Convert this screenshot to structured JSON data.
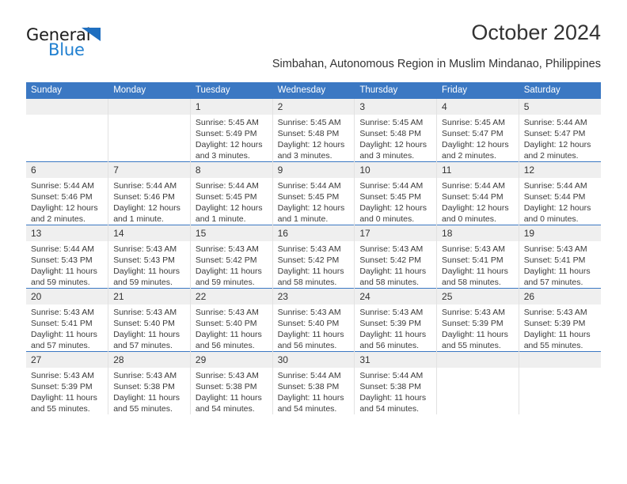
{
  "logo": {
    "word_one": "General",
    "word_two": "Blue",
    "triangle_color": "#1f6fc0",
    "blue_color": "#1f7fd0"
  },
  "header": {
    "title": "October 2024",
    "subtitle": "Simbahan, Autonomous Region in Muslim Mindanao, Philippines"
  },
  "theme": {
    "header_blue": "#3b78c3",
    "daynum_band": "#efefef",
    "cell_border": "#e2e2e2"
  },
  "weekday_headers": [
    "Sunday",
    "Monday",
    "Tuesday",
    "Wednesday",
    "Thursday",
    "Friday",
    "Saturday"
  ],
  "weeks": [
    [
      {
        "day": "",
        "lines": []
      },
      {
        "day": "",
        "lines": []
      },
      {
        "day": "1",
        "lines": [
          "Sunrise: 5:45 AM",
          "Sunset: 5:49 PM",
          "Daylight: 12 hours",
          "and 3 minutes."
        ]
      },
      {
        "day": "2",
        "lines": [
          "Sunrise: 5:45 AM",
          "Sunset: 5:48 PM",
          "Daylight: 12 hours",
          "and 3 minutes."
        ]
      },
      {
        "day": "3",
        "lines": [
          "Sunrise: 5:45 AM",
          "Sunset: 5:48 PM",
          "Daylight: 12 hours",
          "and 3 minutes."
        ]
      },
      {
        "day": "4",
        "lines": [
          "Sunrise: 5:45 AM",
          "Sunset: 5:47 PM",
          "Daylight: 12 hours",
          "and 2 minutes."
        ]
      },
      {
        "day": "5",
        "lines": [
          "Sunrise: 5:44 AM",
          "Sunset: 5:47 PM",
          "Daylight: 12 hours",
          "and 2 minutes."
        ]
      }
    ],
    [
      {
        "day": "6",
        "lines": [
          "Sunrise: 5:44 AM",
          "Sunset: 5:46 PM",
          "Daylight: 12 hours",
          "and 2 minutes."
        ]
      },
      {
        "day": "7",
        "lines": [
          "Sunrise: 5:44 AM",
          "Sunset: 5:46 PM",
          "Daylight: 12 hours",
          "and 1 minute."
        ]
      },
      {
        "day": "8",
        "lines": [
          "Sunrise: 5:44 AM",
          "Sunset: 5:45 PM",
          "Daylight: 12 hours",
          "and 1 minute."
        ]
      },
      {
        "day": "9",
        "lines": [
          "Sunrise: 5:44 AM",
          "Sunset: 5:45 PM",
          "Daylight: 12 hours",
          "and 1 minute."
        ]
      },
      {
        "day": "10",
        "lines": [
          "Sunrise: 5:44 AM",
          "Sunset: 5:45 PM",
          "Daylight: 12 hours",
          "and 0 minutes."
        ]
      },
      {
        "day": "11",
        "lines": [
          "Sunrise: 5:44 AM",
          "Sunset: 5:44 PM",
          "Daylight: 12 hours",
          "and 0 minutes."
        ]
      },
      {
        "day": "12",
        "lines": [
          "Sunrise: 5:44 AM",
          "Sunset: 5:44 PM",
          "Daylight: 12 hours",
          "and 0 minutes."
        ]
      }
    ],
    [
      {
        "day": "13",
        "lines": [
          "Sunrise: 5:44 AM",
          "Sunset: 5:43 PM",
          "Daylight: 11 hours",
          "and 59 minutes."
        ]
      },
      {
        "day": "14",
        "lines": [
          "Sunrise: 5:43 AM",
          "Sunset: 5:43 PM",
          "Daylight: 11 hours",
          "and 59 minutes."
        ]
      },
      {
        "day": "15",
        "lines": [
          "Sunrise: 5:43 AM",
          "Sunset: 5:42 PM",
          "Daylight: 11 hours",
          "and 59 minutes."
        ]
      },
      {
        "day": "16",
        "lines": [
          "Sunrise: 5:43 AM",
          "Sunset: 5:42 PM",
          "Daylight: 11 hours",
          "and 58 minutes."
        ]
      },
      {
        "day": "17",
        "lines": [
          "Sunrise: 5:43 AM",
          "Sunset: 5:42 PM",
          "Daylight: 11 hours",
          "and 58 minutes."
        ]
      },
      {
        "day": "18",
        "lines": [
          "Sunrise: 5:43 AM",
          "Sunset: 5:41 PM",
          "Daylight: 11 hours",
          "and 58 minutes."
        ]
      },
      {
        "day": "19",
        "lines": [
          "Sunrise: 5:43 AM",
          "Sunset: 5:41 PM",
          "Daylight: 11 hours",
          "and 57 minutes."
        ]
      }
    ],
    [
      {
        "day": "20",
        "lines": [
          "Sunrise: 5:43 AM",
          "Sunset: 5:41 PM",
          "Daylight: 11 hours",
          "and 57 minutes."
        ]
      },
      {
        "day": "21",
        "lines": [
          "Sunrise: 5:43 AM",
          "Sunset: 5:40 PM",
          "Daylight: 11 hours",
          "and 57 minutes."
        ]
      },
      {
        "day": "22",
        "lines": [
          "Sunrise: 5:43 AM",
          "Sunset: 5:40 PM",
          "Daylight: 11 hours",
          "and 56 minutes."
        ]
      },
      {
        "day": "23",
        "lines": [
          "Sunrise: 5:43 AM",
          "Sunset: 5:40 PM",
          "Daylight: 11 hours",
          "and 56 minutes."
        ]
      },
      {
        "day": "24",
        "lines": [
          "Sunrise: 5:43 AM",
          "Sunset: 5:39 PM",
          "Daylight: 11 hours",
          "and 56 minutes."
        ]
      },
      {
        "day": "25",
        "lines": [
          "Sunrise: 5:43 AM",
          "Sunset: 5:39 PM",
          "Daylight: 11 hours",
          "and 55 minutes."
        ]
      },
      {
        "day": "26",
        "lines": [
          "Sunrise: 5:43 AM",
          "Sunset: 5:39 PM",
          "Daylight: 11 hours",
          "and 55 minutes."
        ]
      }
    ],
    [
      {
        "day": "27",
        "lines": [
          "Sunrise: 5:43 AM",
          "Sunset: 5:39 PM",
          "Daylight: 11 hours",
          "and 55 minutes."
        ]
      },
      {
        "day": "28",
        "lines": [
          "Sunrise: 5:43 AM",
          "Sunset: 5:38 PM",
          "Daylight: 11 hours",
          "and 55 minutes."
        ]
      },
      {
        "day": "29",
        "lines": [
          "Sunrise: 5:43 AM",
          "Sunset: 5:38 PM",
          "Daylight: 11 hours",
          "and 54 minutes."
        ]
      },
      {
        "day": "30",
        "lines": [
          "Sunrise: 5:44 AM",
          "Sunset: 5:38 PM",
          "Daylight: 11 hours",
          "and 54 minutes."
        ]
      },
      {
        "day": "31",
        "lines": [
          "Sunrise: 5:44 AM",
          "Sunset: 5:38 PM",
          "Daylight: 11 hours",
          "and 54 minutes."
        ]
      },
      {
        "day": "",
        "lines": []
      },
      {
        "day": "",
        "lines": []
      }
    ]
  ]
}
